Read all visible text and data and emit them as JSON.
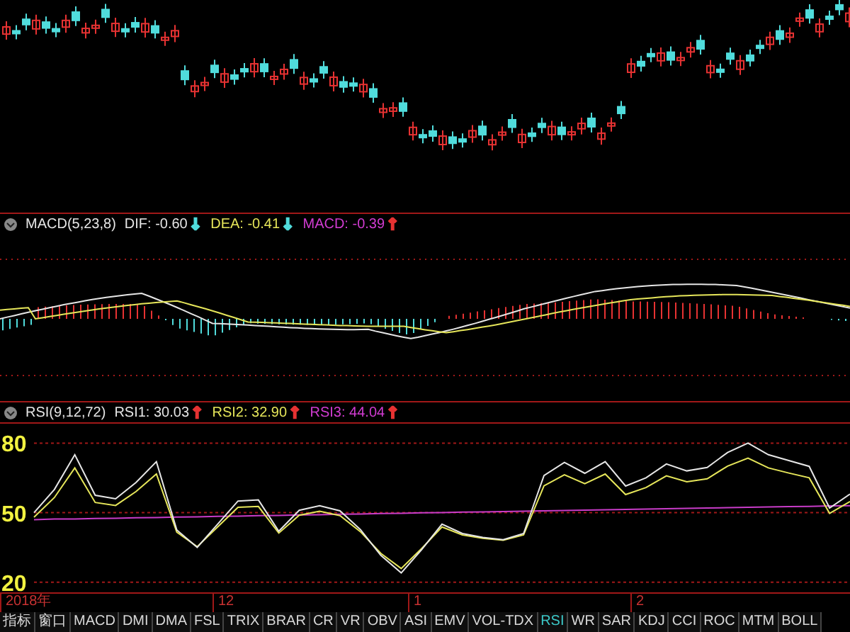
{
  "macd": {
    "title": "MACD(5,23,8)",
    "readings": [
      {
        "text": "DIF: -0.60",
        "color": "#e6e6e6",
        "arrow": {
          "text": "↓",
          "color": "#50dcdc"
        }
      },
      {
        "text": "DEA: -0.41",
        "color": "#e6e65a",
        "arrow": {
          "text": "↓",
          "color": "#50dcdc"
        }
      },
      {
        "text": "MACD: -0.39",
        "color": "#d23cd2",
        "arrow": {
          "text": "↑",
          "color": "#e63232"
        }
      }
    ]
  },
  "rsi": {
    "title": "RSI(9,12,72)",
    "readings": [
      {
        "text": "RSI1: 30.03",
        "color": "#e6e6e6",
        "arrow": {
          "text": "↑",
          "color": "#e63232"
        }
      },
      {
        "text": "RSI2: 32.90",
        "color": "#e6e65a",
        "arrow": {
          "text": "↑",
          "color": "#e63232"
        }
      },
      {
        "text": "RSI3: 44.04",
        "color": "#d23cd2",
        "arrow": {
          "text": "↑",
          "color": "#e63232"
        }
      }
    ],
    "chart_data": {
      "type": "line",
      "ylim": [
        15,
        89
      ],
      "yticks": [
        80,
        50,
        20
      ],
      "grid": true,
      "series": [
        {
          "color": "#c83cc8",
          "values": [
            47.0,
            47.2,
            47.3,
            47.5,
            47.6,
            47.8,
            47.9,
            48.1,
            48.2,
            48.4,
            48.5,
            48.7,
            48.8,
            49.0,
            49.1,
            49.3,
            49.4,
            49.6,
            49.7,
            49.9,
            50.0,
            50.2,
            50.3,
            50.5,
            50.6,
            50.8,
            50.9,
            51.1,
            51.2,
            51.4,
            51.5,
            51.7,
            51.8,
            52.0,
            52.1,
            52.3,
            52.4,
            52.6,
            52.7,
            52.9,
            53.0
          ]
        },
        {
          "color": "#e6e65a",
          "values": [
            48,
            56.5,
            69.3,
            54.4,
            53.1,
            59.1,
            66.7,
            41.6,
            35.3,
            43.8,
            52.3,
            52.7,
            41.2,
            48.9,
            50.6,
            48.7,
            41.8,
            32.4,
            25.9,
            34.5,
            43.8,
            40.4,
            38.9,
            38.1,
            40.4,
            61.6,
            66.4,
            62.5,
            66.7,
            57.8,
            60.8,
            65.9,
            63.3,
            64.6,
            70.1,
            73.5,
            69.3,
            67.1,
            65,
            49.7,
            54.8
          ]
        },
        {
          "color": "#e6e6e6",
          "values": [
            50,
            60,
            75,
            57.5,
            56,
            63,
            72,
            42.5,
            35,
            45,
            55,
            55.5,
            42,
            51,
            53,
            50.8,
            42.7,
            31.6,
            24,
            34,
            45,
            41,
            39.3,
            38.3,
            41,
            66,
            71.7,
            67,
            72,
            61.5,
            65,
            71,
            68,
            69.5,
            76,
            80,
            75,
            72.5,
            70,
            52,
            58
          ]
        }
      ]
    }
  },
  "date_axis": [
    "2018年",
    "12",
    "1",
    "2"
  ],
  "tabs": [
    {
      "label": "指标",
      "selected": false
    },
    {
      "label": "窗口",
      "selected": false
    },
    {
      "label": "MACD",
      "selected": false
    },
    {
      "label": "DMI",
      "selected": false
    },
    {
      "label": "DMA",
      "selected": false
    },
    {
      "label": "FSL",
      "selected": false
    },
    {
      "label": "TRIX",
      "selected": false
    },
    {
      "label": "BRAR",
      "selected": false
    },
    {
      "label": "CR",
      "selected": false
    },
    {
      "label": "VR",
      "selected": false
    },
    {
      "label": "OBV",
      "selected": false
    },
    {
      "label": "ASI",
      "selected": false
    },
    {
      "label": "EMV",
      "selected": false
    },
    {
      "label": "VOL-TDX",
      "selected": false
    },
    {
      "label": "RSI",
      "selected": true
    },
    {
      "label": "WR",
      "selected": false
    },
    {
      "label": "SAR",
      "selected": false
    },
    {
      "label": "KDJ",
      "selected": false
    },
    {
      "label": "CCI",
      "selected": false
    },
    {
      "label": "ROC",
      "selected": false
    },
    {
      "label": "MTM",
      "selected": false
    },
    {
      "label": "BOLL",
      "selected": false
    }
  ]
}
